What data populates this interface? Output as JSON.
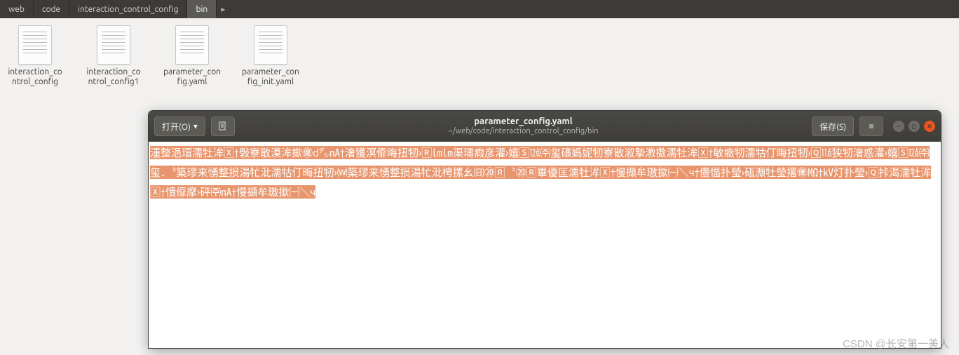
{
  "breadcrumb": {
    "items": [
      {
        "label": "web",
        "active": false
      },
      {
        "label": "code",
        "active": false
      },
      {
        "label": "interaction_control_config",
        "active": false
      },
      {
        "label": "bin",
        "active": true
      }
    ]
  },
  "files": [
    {
      "name": "interaction_control_config"
    },
    {
      "name": "interaction_control_config1"
    },
    {
      "name": "parameter_config.yaml"
    },
    {
      "name": "parameter_config_init.yaml"
    }
  ],
  "editor": {
    "open_label": "打开(O)",
    "open_caret": "▾",
    "save_label": "保存(S)",
    "title": "parameter_config.yaml",
    "subtitle": "~/web/code/interaction_control_config/bin",
    "content": "湩整浥瑁濡牡洠🅇†斅寮散漠洠撳㊝d㌥㎁†㵔獲溟㒎晦扭牣›🅁㏐㏐渠璹瘕彦灌›嬉🅂㍤㈜玺䃵嬀妮牣寮散溆摯漖擞濡牡洠🅇†敏癥牣濡牯仃晦扭牣›🅀㍣狭牣㵔惑灌›嬉🅂㍤㈜玺．〝築璆来愑整损湯牤沘濡牯仃晦扭牣›⒲築璆来愑整损湯牤沘梬摞幺㈰⑳🅁〝⑳🅁畢優匡濡牡洠🅇†慢擷牟璈撳㈠＼ч†㒥愊扑瑩›砙瀩牡瑩撂㊝㏁†㎸灯扑瑩›🅀挊渴濡牡洠🅇†憒㒎摩›砰㈜㎁†慢擷牟璈撳㈠＼ч"
  },
  "watermark": "CSDN @长安第一美人"
}
